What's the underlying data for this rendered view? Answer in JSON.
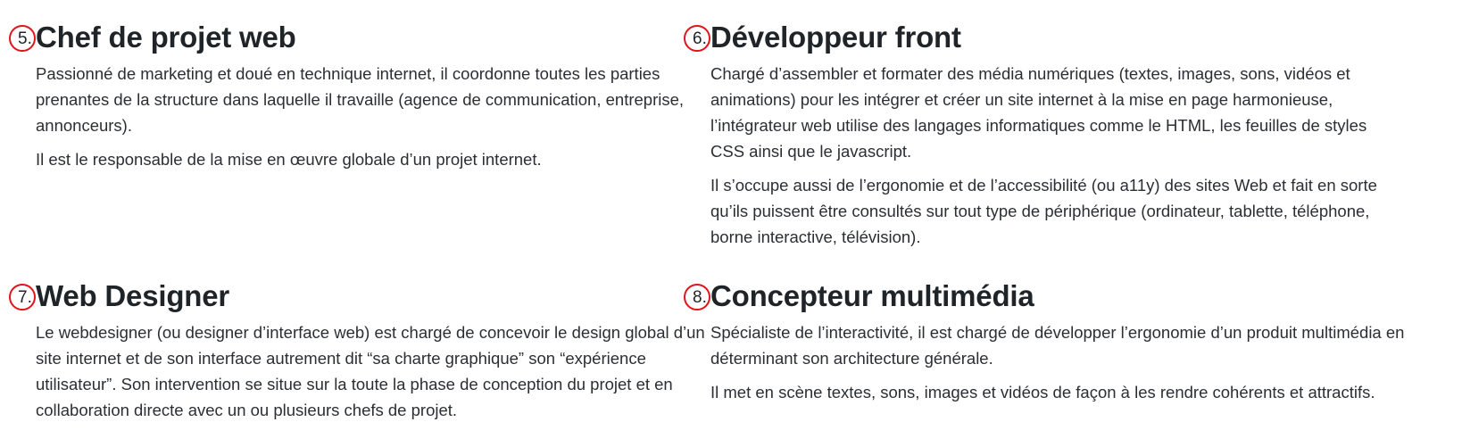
{
  "sections": [
    {
      "number": "5.",
      "title": "Chef de projet web",
      "paragraphs": [
        "Passionné de marketing et doué en technique internet, il coordonne toutes les parties prenantes de la structure dans laquelle il travaille (agence de communication, entreprise, annonceurs).",
        "Il est le responsable de la mise en œuvre globale d’un projet internet."
      ]
    },
    {
      "number": "6.",
      "title": "Développeur front",
      "paragraphs": [
        "Chargé d’assembler et formater des média numériques (textes, images, sons, vidéos et animations) pour les intégrer et créer un site internet à la mise en page harmonieuse, l’intégrateur web utilise des langages informatiques comme le HTML, les feuilles de styles CSS ainsi que le javascript.",
        "Il s’occupe aussi de l’ergonomie et de l’accessibilité (ou a11y) des sites Web et fait en sorte qu’ils puissent être consultés sur tout type de périphérique (ordinateur, tablette, téléphone, borne interactive, télévision)."
      ]
    },
    {
      "number": "7.",
      "title": "Web Designer",
      "paragraphs": [
        "Le webdesigner (ou designer d’interface web) est chargé de concevoir le design global d’un site internet et de son interface autrement dit “sa charte graphique” son “expérience utilisateur”. Son intervention se situe sur la toute la phase de conception du projet et en collaboration directe avec un ou plusieurs chefs de projet."
      ]
    },
    {
      "number": "8.",
      "title": "Concepteur multimédia",
      "paragraphs": [
        "Spécialiste de l’interactivité, il est chargé de développer l’ergonomie d’un produit multimédia en déterminant son architecture générale.",
        "Il met en scène textes, sons, images et vidéos de façon à les rendre cohérents et attractifs."
      ]
    }
  ],
  "colors": {
    "badge_circle": "#e0141b",
    "text": "#212529"
  }
}
